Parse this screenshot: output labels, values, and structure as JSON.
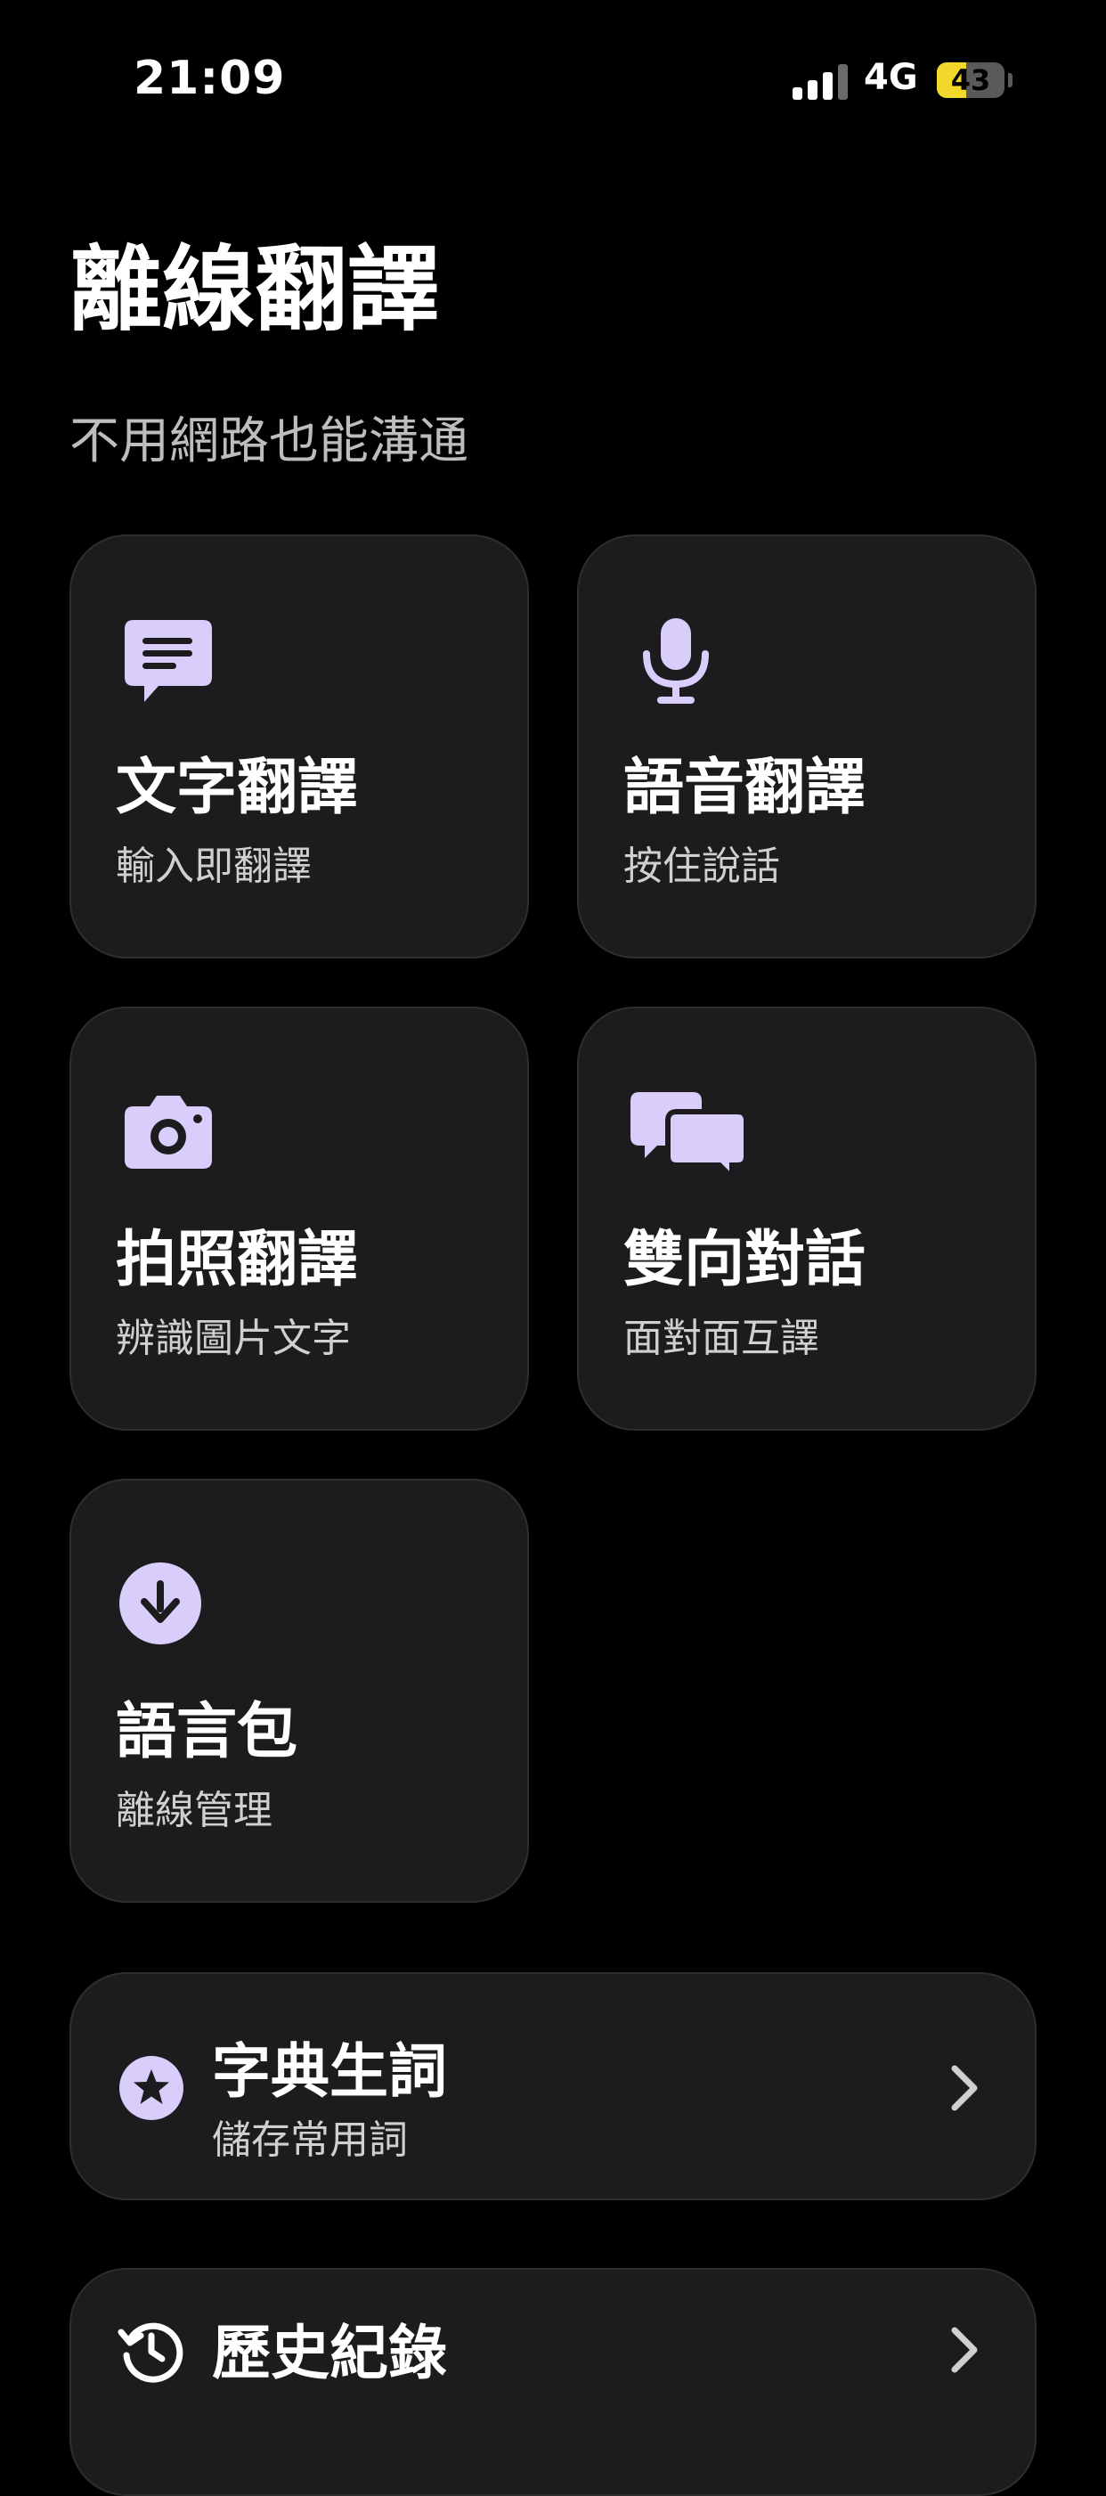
{
  "status_bar": {
    "time": "21:09",
    "network": "4G",
    "battery": "43",
    "battery_level": 0.43,
    "battery_color": "#f2d82a"
  },
  "header": {
    "title": "離線翻譯",
    "subtitle": "不用網路也能溝通"
  },
  "accent_color": "#d9cdfb",
  "cards": [
    {
      "icon": "chat-bubble-icon",
      "title": "文字翻譯",
      "subtitle": "輸入即翻譯"
    },
    {
      "icon": "microphone-icon",
      "title": "語音翻譯",
      "subtitle": "按住說話"
    },
    {
      "icon": "camera-icon",
      "title": "拍照翻譯",
      "subtitle": "辨識圖片文字"
    },
    {
      "icon": "conversation-icon",
      "title": "雙向對話",
      "subtitle": "面對面互譯"
    },
    {
      "icon": "download-icon",
      "title": "語言包",
      "subtitle": "離線管理"
    }
  ],
  "rows": [
    {
      "icon": "star-icon",
      "title": "字典生詞",
      "subtitle": "儲存常用詞"
    },
    {
      "icon": "history-icon",
      "title": "歷史紀錄"
    }
  ]
}
